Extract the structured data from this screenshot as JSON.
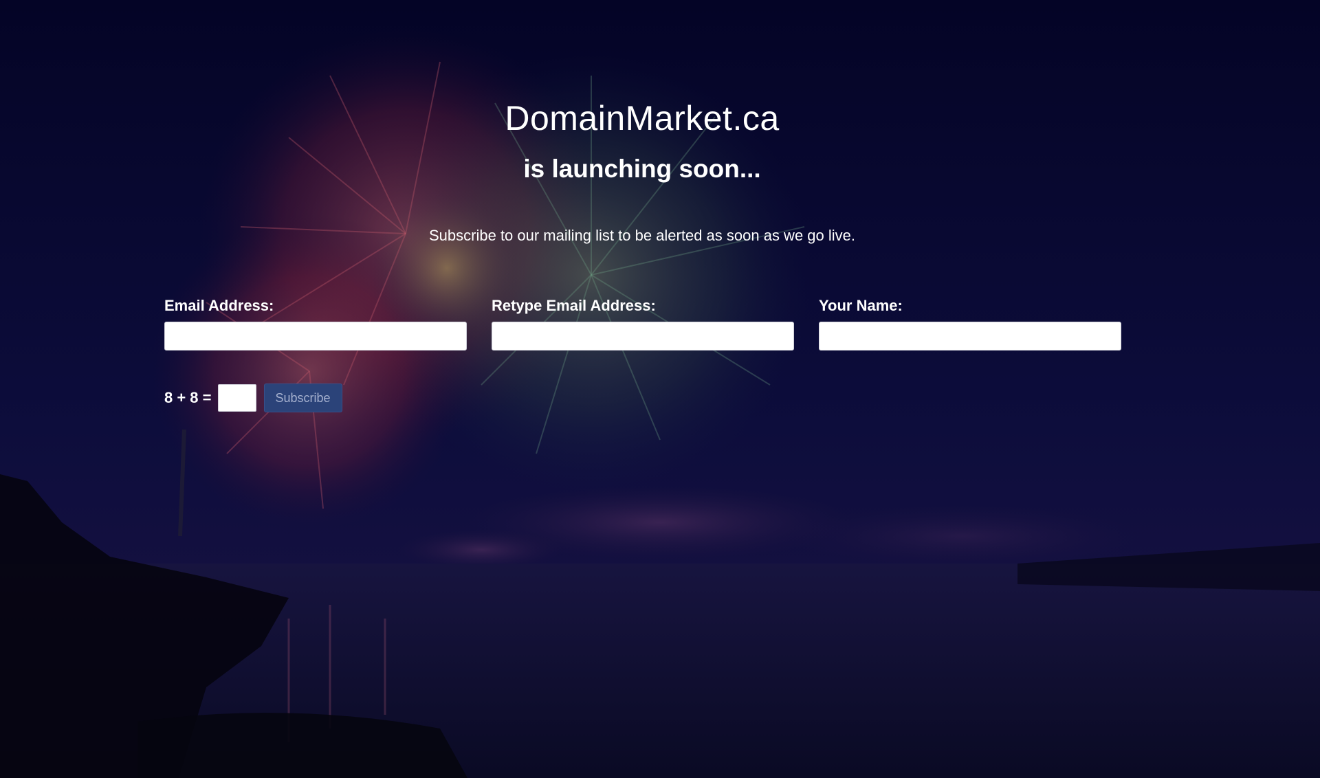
{
  "site": {
    "title": "DomainMarket.ca",
    "tagline": "is launching soon...",
    "intro": "Subscribe to our mailing list to be alerted as soon as we go live."
  },
  "form": {
    "email_label": "Email Address:",
    "email_value": "",
    "retype_email_label": "Retype Email Address:",
    "retype_email_value": "",
    "name_label": "Your Name:",
    "name_value": "",
    "captcha_label": "8 + 8 =",
    "captcha_value": "",
    "subscribe_label": "Subscribe"
  },
  "colors": {
    "background": "#0b0a2a",
    "button": "#2b4379",
    "button_text": "#a6b1cf",
    "text": "#ffffff"
  },
  "background_image": "fireworks-over-harbor-at-night"
}
